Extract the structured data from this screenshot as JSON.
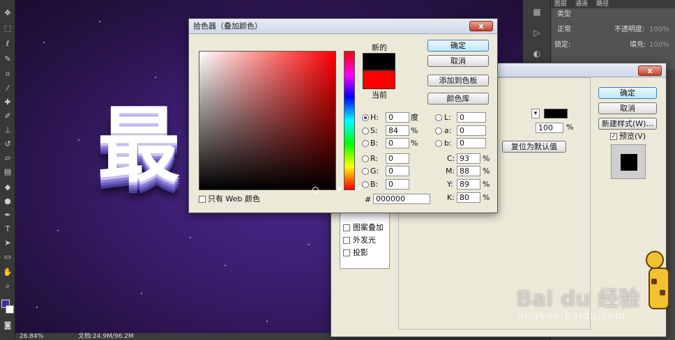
{
  "colors": {
    "accent": "#3c7fb1",
    "new_color": "#000000",
    "current_color": "#ff0000",
    "canvas": "#3a1d6e"
  },
  "canvas": {
    "big_text": "最",
    "big_text_2": "最"
  },
  "status": {
    "zoom": "26.84%",
    "doc": "文档:24.9M/96.2M"
  },
  "layers_panel": {
    "tabs": [
      "图层",
      "通道",
      "路径"
    ],
    "kind_label": "类型",
    "blend_mode": "正常",
    "opacity_label": "不透明度:",
    "opacity_value": "100%",
    "lock_label": "锁定:",
    "fill_label": "填充:",
    "fill_value": "100%"
  },
  "layer_style": {
    "ok": "确定",
    "cancel": "取消",
    "new_style": "新建样式(W)...",
    "preview": "预览(V)",
    "opacity_value": "100",
    "opacity_unit": "%",
    "reset_default": "复位为默认值",
    "style_items": [
      "图案叠加",
      "外发光",
      "投影"
    ]
  },
  "picker": {
    "title": "拾色器（叠加颜色）",
    "close": "x",
    "ok": "确定",
    "cancel": "取消",
    "add_swatch": "添加到色板",
    "libraries": "颜色库",
    "new_label": "新的",
    "current_label": "当前",
    "web_only": "只有 Web 颜色",
    "hsb": [
      {
        "label": "H:",
        "value": "0",
        "unit": "度",
        "selected": true
      },
      {
        "label": "S:",
        "value": "84",
        "unit": "%",
        "selected": false
      },
      {
        "label": "B:",
        "value": "0",
        "unit": "%",
        "selected": false
      }
    ],
    "rgb": [
      {
        "label": "R:",
        "value": "0"
      },
      {
        "label": "G:",
        "value": "0"
      },
      {
        "label": "B:",
        "value": "0"
      }
    ],
    "lab": [
      {
        "label": "L:",
        "value": "0"
      },
      {
        "label": "a:",
        "value": "0"
      },
      {
        "label": "b:",
        "value": "0"
      }
    ],
    "cmyk": [
      {
        "label": "C:",
        "value": "93",
        "unit": "%"
      },
      {
        "label": "M:",
        "value": "88",
        "unit": "%"
      },
      {
        "label": "Y:",
        "value": "89",
        "unit": "%"
      },
      {
        "label": "K:",
        "value": "80",
        "unit": "%"
      }
    ],
    "hex_label": "#",
    "hex_value": "000000"
  },
  "watermark": {
    "brand": "Bai du 经验",
    "url": "jingyan.baidu.com"
  }
}
